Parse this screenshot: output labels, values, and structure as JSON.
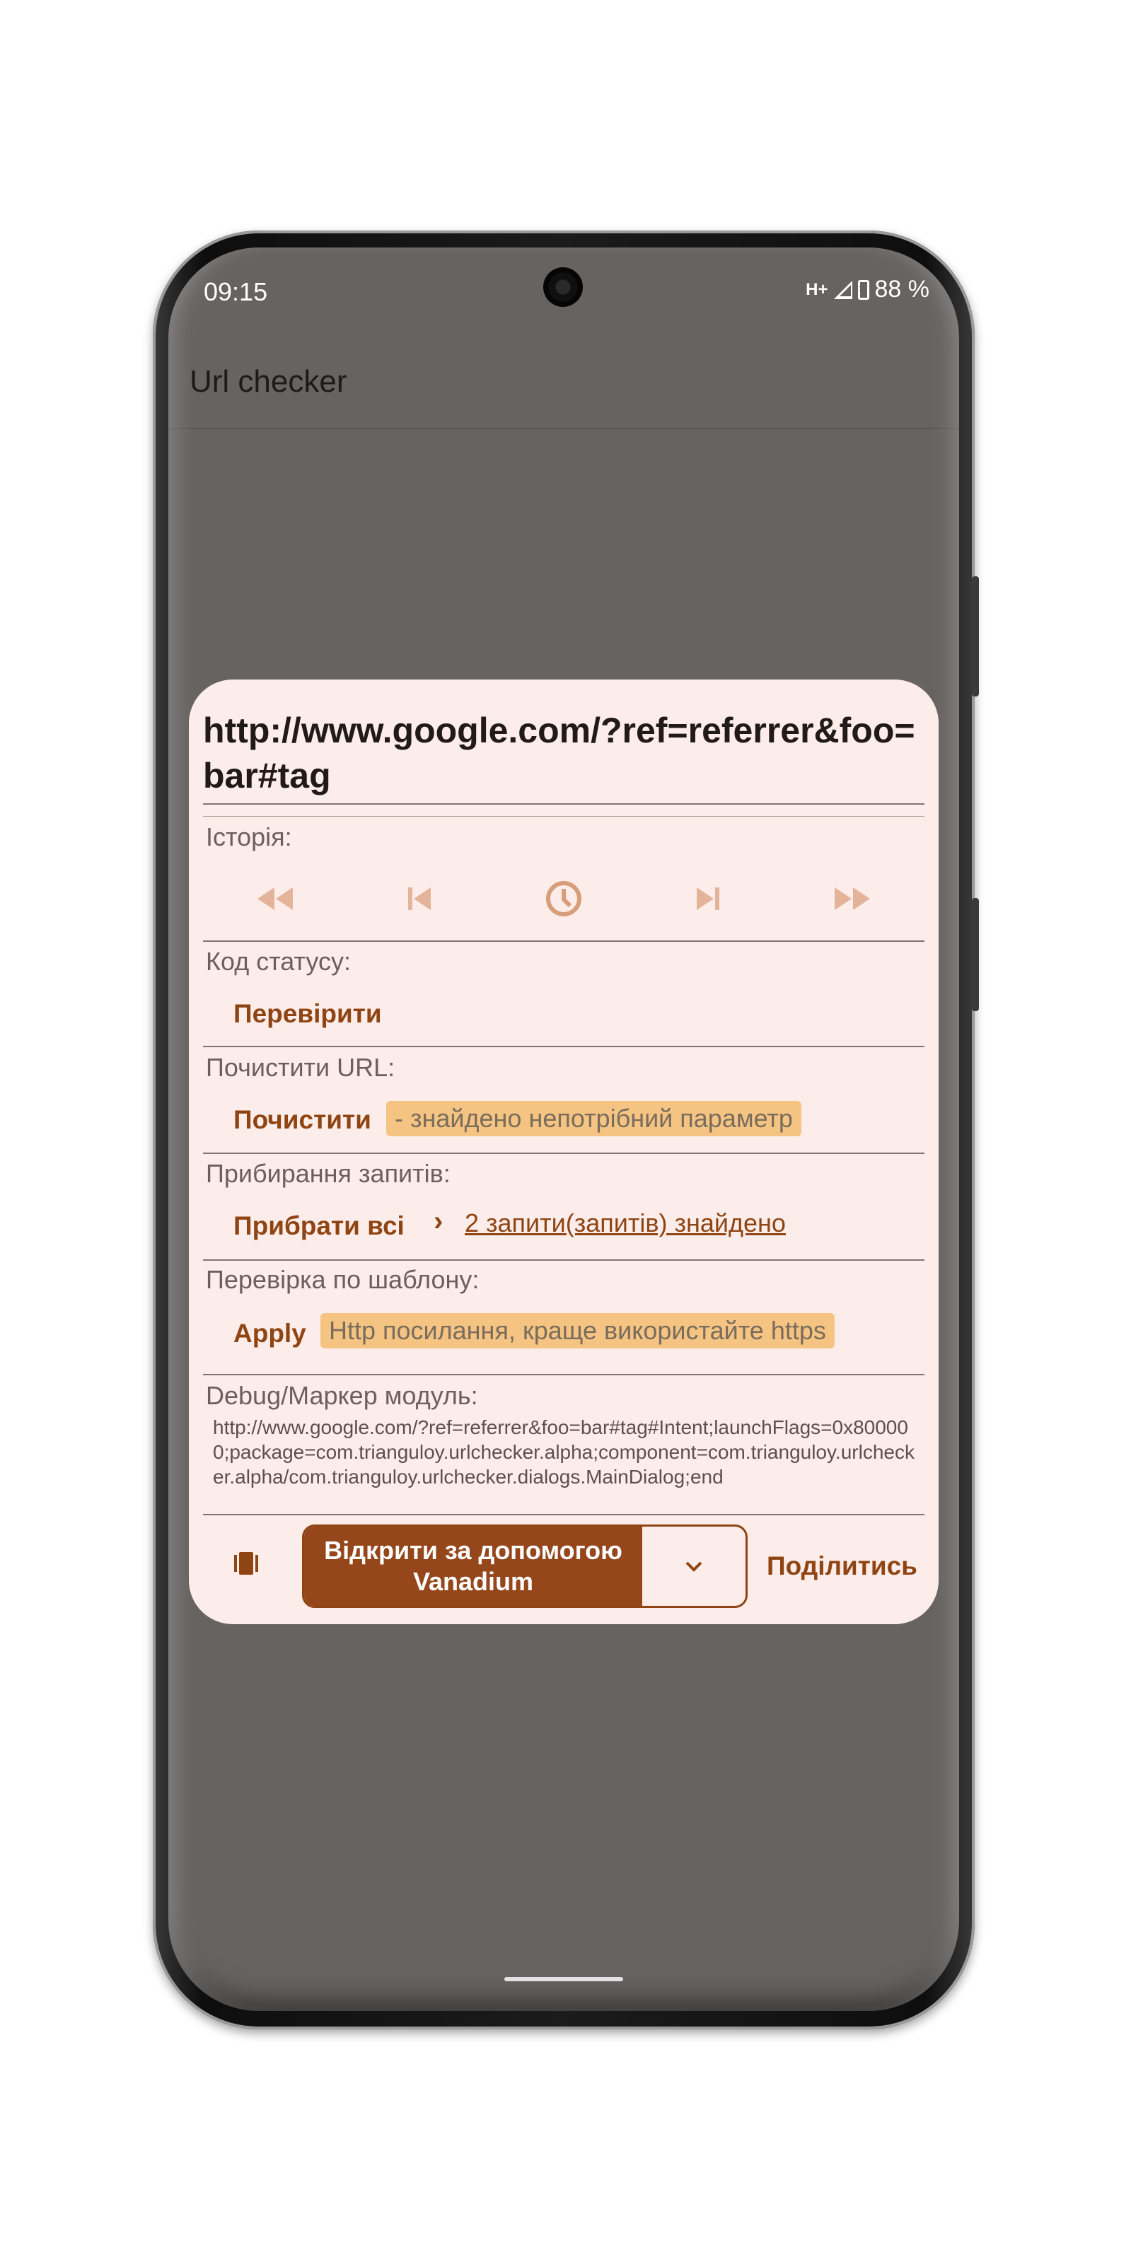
{
  "status_bar": {
    "time": "09:15",
    "network": "H+",
    "battery": "88 %"
  },
  "app_bar": {
    "title": "Url checker"
  },
  "dialog": {
    "url": "http://www.google.com/?ref=referrer&foo=bar#tag",
    "history": {
      "label": "Історія:"
    },
    "status_code": {
      "label": "Код статусу:",
      "button": "Перевірити"
    },
    "clear_url": {
      "label": "Почистити URL:",
      "button": "Почистити",
      "info": "- знайдено непотрібний параметр"
    },
    "queries": {
      "label": "Прибирання запитів:",
      "button": "Прибрати всі",
      "link": "2 запити(запитів) знайдено"
    },
    "pattern": {
      "label": "Перевірка по шаблону:",
      "button": "Apply",
      "info": "Http посилання, краще використайте https"
    },
    "debug": {
      "label": "Debug/Маркер модуль:",
      "text": "http://www.google.com/?ref=referrer&foo=bar#tag#Intent;launchFlags=0x800000;package=com.trianguloy.urlchecker.alpha;component=com.trianguloy.urlchecker.alpha/com.trianguloy.urlchecker.dialogs.MainDialog;end"
    },
    "actions": {
      "open_line1": "Відкрити за допомогою",
      "open_line2": "Vanadium",
      "share": "Поділитись"
    }
  },
  "colors": {
    "accent": "#95461b",
    "dialog_bg": "#fdedea",
    "chip": "#f5c483",
    "scrim": "#666361"
  }
}
